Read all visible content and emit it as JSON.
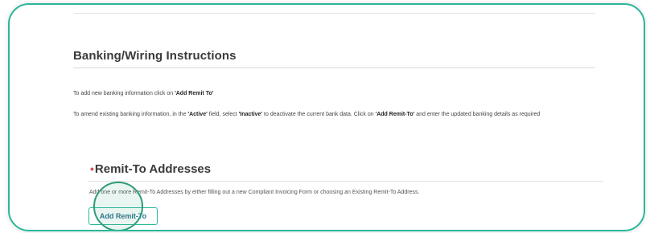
{
  "banking": {
    "title": "Banking/Wiring Instructions",
    "add_prefix": "To add new banking information click on ",
    "add_link_text": "'Add Remit To'",
    "amend_prefix": "To amend existing banking information, in the ",
    "amend_active": "'Active'",
    "amend_mid1": " field, select ",
    "amend_inactive": "'Inactive'",
    "amend_mid2": " to deactivate the current bank data. Click on ",
    "amend_add": "'Add Remit-To'",
    "amend_suffix": " and enter the updated banking details as required"
  },
  "remit": {
    "required_mark": "•",
    "title": "Remit-To Addresses",
    "description": "Add one or more Remit-To Addresses by either filling out a new Compliant Invoicing Form or choosing an Existing Remit-To Address.",
    "add_button_label": "Add Remit-To"
  },
  "colors": {
    "accent": "#2bb89a",
    "required": "#d9534f",
    "button_text": "#2a6f8f"
  }
}
